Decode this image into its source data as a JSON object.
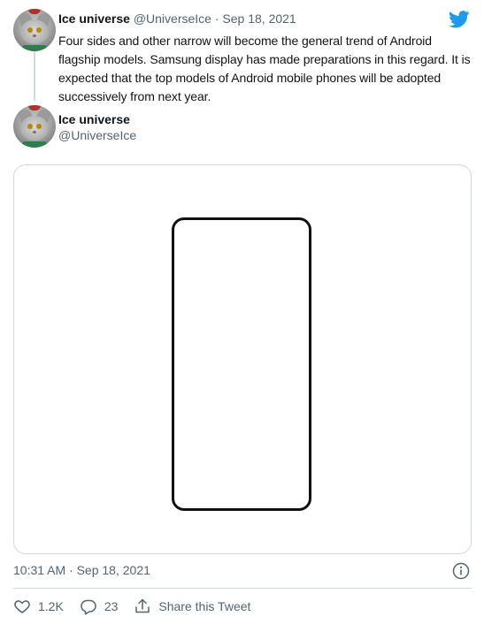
{
  "tweet1": {
    "author_name": "Ice universe",
    "handle": "@UniverseIce",
    "separator": "·",
    "date": "Sep 18, 2021",
    "text": "Four sides and other narrow will become the general trend of Android flagship models. Samsung display has made preparations in this regard. It is expected that the top models of Android mobile phones will be adopted successively from next year."
  },
  "tweet2": {
    "author_name": "Ice universe",
    "handle": "@UniverseIce",
    "timestamp": "10:31 AM · Sep 18, 2021"
  },
  "actions": {
    "like_count": "1.2K",
    "reply_count": "23",
    "share_label": "Share this Tweet"
  },
  "icons": {
    "brand": "twitter-bird-icon",
    "info": "info-icon",
    "like": "heart-icon",
    "reply": "reply-bubble-icon",
    "share": "share-icon"
  },
  "colors": {
    "brand": "#1d9bf0",
    "text": "#0f1419",
    "muted": "#536471",
    "border": "#cfd9de"
  }
}
